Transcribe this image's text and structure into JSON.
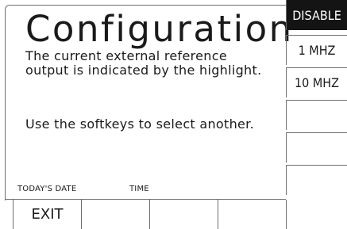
{
  "main": {
    "title": "Configuration",
    "paragraph1": "The current external reference output is indicated by the highlight.",
    "paragraph2": "Use the softkeys to select another."
  },
  "footer": {
    "date_label": "TODAY'S DATE",
    "time_label": "TIME"
  },
  "softkeys": [
    {
      "label": "DISABLE",
      "selected": true
    },
    {
      "label": "1 MHZ",
      "selected": false
    },
    {
      "label": "10 MHZ",
      "selected": false
    },
    {
      "label": "",
      "selected": false
    },
    {
      "label": "",
      "selected": false
    },
    {
      "label": "",
      "selected": false
    }
  ],
  "bottom_keys": [
    {
      "label": "EXIT"
    },
    {
      "label": ""
    },
    {
      "label": ""
    },
    {
      "label": ""
    },
    {
      "label": ""
    }
  ],
  "colors": {
    "selected_background": "#141414",
    "selected_text": "#ffffff",
    "border": "#6e6e6e"
  }
}
